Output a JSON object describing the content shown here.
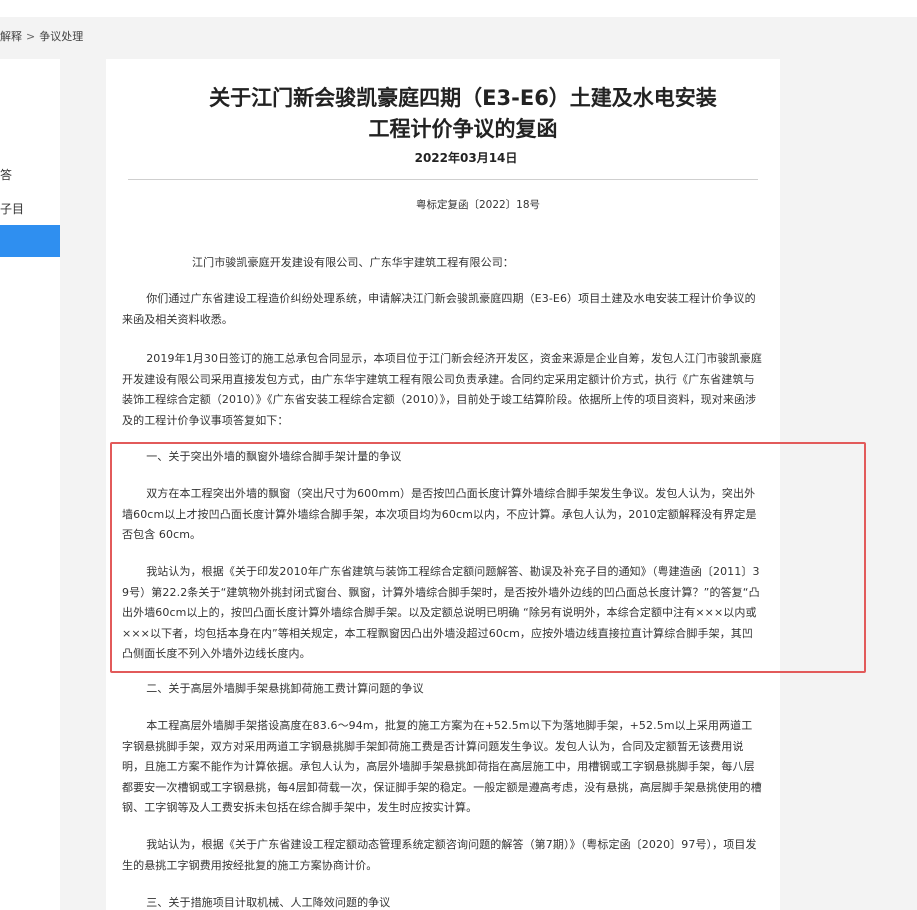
{
  "breadcrumb": {
    "parent": "解释",
    "separator": ">",
    "current": "争议处理"
  },
  "sidebar": {
    "items": [
      {
        "label": "答"
      },
      {
        "label": "子目"
      }
    ]
  },
  "document": {
    "title_line1": "关于江门新会骏凯豪庭四期（E3-E6）土建及水电安装",
    "title_line2": "工程计价争议的复函",
    "date": "2022年03月14日",
    "doc_number": "粤标定复函〔2022〕18号",
    "addressee": "江门市骏凯豪庭开发建设有限公司、广东华宇建筑工程有限公司：",
    "paragraphs": [
      "你们通过广东省建设工程造价纠纷处理系统，申请解决江门新会骏凯豪庭四期（E3-E6）项目土建及水电安装工程计价争议的来函及相关资料收悉。",
      "2019年1月30日签订的施工总承包合同显示，本项目位于江门新会经济开发区，资金来源是企业自筹，发包人江门市骏凯豪庭开发建设有限公司采用直接发包方式，由广东华宇建筑工程有限公司负责承建。合同约定采用定额计价方式，执行《广东省建筑与装饰工程综合定额（2010）》《广东省安装工程综合定额（2010）》，目前处于竣工结算阶段。依据所上传的项目资料，现对来函涉及的工程计价争议事项答复如下：",
      "一、关于突出外墙的飘窗外墙综合脚手架计量的争议",
      "双方在本工程突出外墙的飘窗（突出尺寸为600mm）是否按凹凸面长度计算外墙综合脚手架发生争议。发包人认为，突出外墙60cm以上才按凹凸面长度计算外墙综合脚手架，本次项目均为60cm以内，不应计算。承包人认为，2010定额解释没有界定是否包含 60cm。",
      "我站认为，根据《关于印发2010年广东省建筑与装饰工程综合定额问题解答、勘误及补充子目的通知》（粤建造函〔2011〕39号）第22.2条关于“建筑物外挑封闭式窗台、飘窗，计算外墙综合脚手架时，是否按外墙外边线的凹凸面总长度计算？”的答复“凸出外墙60cm以上的，按凹凸面长度计算外墙综合脚手架。以及定额总说明已明确 “除另有说明外，本综合定额中注有×××以内或×××以下者，均包括本身在内”等相关规定，本工程飘窗因凸出外墙没超过60cm，应按外墙边线直接拉直计算综合脚手架，其凹凸侧面长度不列入外墙外边线长度内。",
      "二、关于高层外墙脚手架悬挑卸荷施工费计算问题的争议",
      "本工程高层外墙脚手架搭设高度在83.6～94m，批复的施工方案为在+52.5m以下为落地脚手架，+52.5m以上采用两道工字钢悬挑脚手架，双方对采用两道工字钢悬挑脚手架卸荷施工费是否计算问题发生争议。发包人认为，合同及定额暂无该费用说明，且施工方案不能作为计算依据。承包人认为，高层外墙脚手架悬挑卸荷指在高层施工中，用槽钢或工字钢悬挑脚手架，每八层都要安一次槽钢或工字钢悬挑，每4层卸荷载一次，保证脚手架的稳定。一般定额是遵高考虑，没有悬挑，高层脚手架悬挑使用的槽钢、工字钢等及人工费安拆未包括在综合脚手架中，发生时应按实计算。",
      "我站认为，根据《关于广东省建设工程定额动态管理系统定额咨询问题的解答（第7期）》（粤标定函〔2020〕97号），项目发生的悬挑工字钢费用按经批复的施工方案协商计价。",
      "三、关于措施项目计取机械、人工降效问题的争议"
    ]
  }
}
